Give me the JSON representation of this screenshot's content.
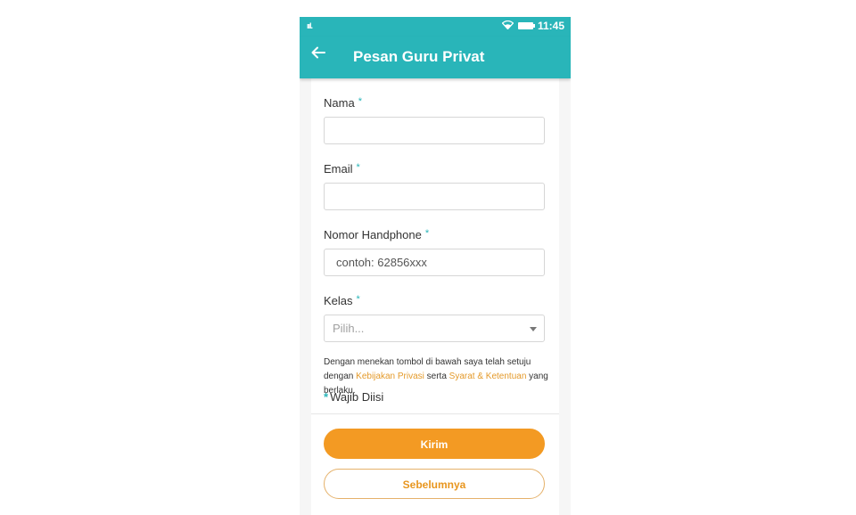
{
  "status_bar": {
    "signal": "ııl.",
    "wifi_icon": "wifi-icon",
    "battery_icon": "battery-icon",
    "time": "11:45"
  },
  "app_bar": {
    "back_icon": "arrow-left-icon",
    "title": "Pesan Guru Privat"
  },
  "form": {
    "required_marker": "*",
    "name": {
      "label": "Nama",
      "value": ""
    },
    "email": {
      "label": "Email",
      "value": ""
    },
    "phone": {
      "label": "Nomor Handphone",
      "placeholder": "contoh: 62856xxx"
    },
    "kelas": {
      "label": "Kelas",
      "selected": "Pilih..."
    }
  },
  "notice": {
    "text_1": "Dengan menekan tombol di bawah saya telah setuju dengan ",
    "privacy_link": "Kebijakan Privasi",
    "text_2": " serta ",
    "terms_link": "Syarat & Ketentuan",
    "text_3": " yang berlaku."
  },
  "mandatory_note": "Wajib Diisi",
  "buttons": {
    "submit": "Kirim",
    "previous": "Sebelumnya"
  },
  "colors": {
    "primary": "#29b5b9",
    "accent": "#f39a23"
  }
}
